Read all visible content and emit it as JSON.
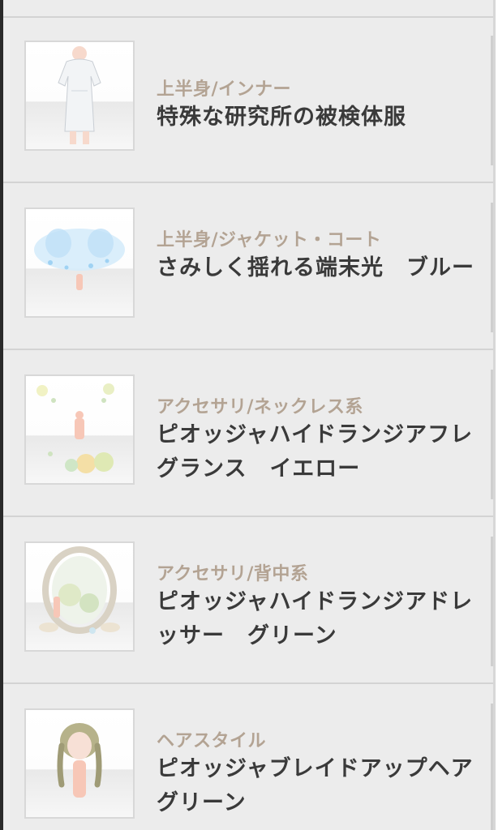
{
  "items": [
    {
      "category": "上半身/インナー",
      "name": "特殊な研究所の被検体服",
      "thumbnail_icon": "white-dress-icon"
    },
    {
      "category": "上半身/ジャケット・コート",
      "name": "さみしく揺れる端末光　ブルー",
      "thumbnail_icon": "blue-light-jacket-icon"
    },
    {
      "category": "アクセサリ/ネックレス系",
      "name": "ピオッジャハイドランジアフレグランス　イエロー",
      "thumbnail_icon": "hydrangea-necklace-icon"
    },
    {
      "category": "アクセサリ/背中系",
      "name": "ピオッジャハイドランジアドレッサー　グリーン",
      "thumbnail_icon": "hydrangea-dresser-icon"
    },
    {
      "category": "ヘアスタイル",
      "name": "ピオッジャブレイドアップヘア　グリーン",
      "thumbnail_icon": "braided-hair-icon"
    }
  ],
  "colors": {
    "category_text": "#b3a393",
    "name_text": "#3a3a3a",
    "row_background": "#ececec",
    "divider": "#d3d3d3"
  }
}
